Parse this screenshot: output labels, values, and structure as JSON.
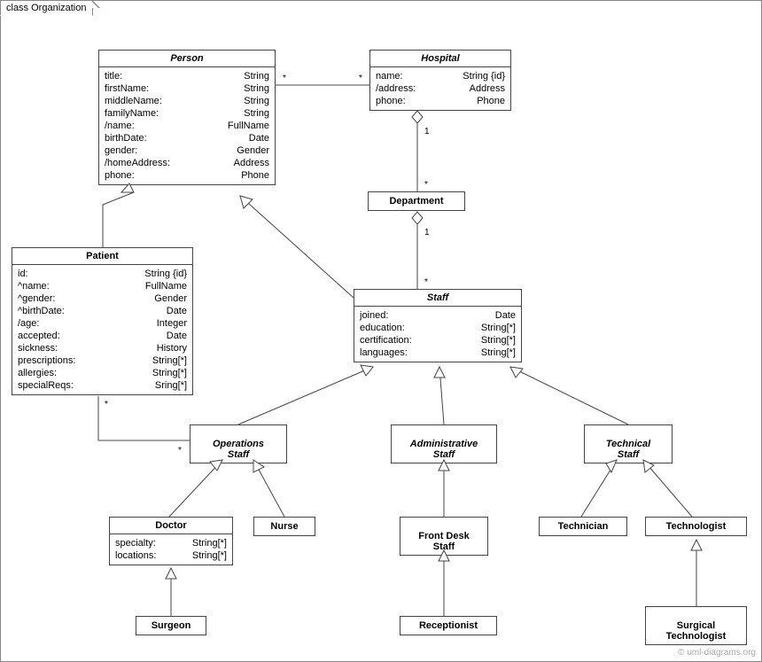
{
  "frame": {
    "title": "class Organization"
  },
  "classes": {
    "person": {
      "name": "Person",
      "attrs": [
        {
          "n": "title:",
          "t": "String"
        },
        {
          "n": "firstName:",
          "t": "String"
        },
        {
          "n": "middleName:",
          "t": "String"
        },
        {
          "n": "familyName:",
          "t": "String"
        },
        {
          "n": "/name:",
          "t": "FullName"
        },
        {
          "n": "birthDate:",
          "t": "Date"
        },
        {
          "n": "gender:",
          "t": "Gender"
        },
        {
          "n": "/homeAddress:",
          "t": "Address"
        },
        {
          "n": "phone:",
          "t": "Phone"
        }
      ]
    },
    "hospital": {
      "name": "Hospital",
      "attrs": [
        {
          "n": "name:",
          "t": "String {id}"
        },
        {
          "n": "/address:",
          "t": "Address"
        },
        {
          "n": "phone:",
          "t": "Phone"
        }
      ]
    },
    "department": {
      "name": "Department"
    },
    "patient": {
      "name": "Patient",
      "attrs": [
        {
          "n": "id:",
          "t": "String {id}"
        },
        {
          "n": "^name:",
          "t": "FullName"
        },
        {
          "n": "^gender:",
          "t": "Gender"
        },
        {
          "n": "^birthDate:",
          "t": "Date"
        },
        {
          "n": "/age:",
          "t": "Integer"
        },
        {
          "n": "accepted:",
          "t": "Date"
        },
        {
          "n": "sickness:",
          "t": "History"
        },
        {
          "n": "prescriptions:",
          "t": "String[*]"
        },
        {
          "n": "allergies:",
          "t": "String[*]"
        },
        {
          "n": "specialReqs:",
          "t": "Sring[*]"
        }
      ]
    },
    "staff": {
      "name": "Staff",
      "attrs": [
        {
          "n": "joined:",
          "t": "Date"
        },
        {
          "n": "education:",
          "t": "String[*]"
        },
        {
          "n": "certification:",
          "t": "String[*]"
        },
        {
          "n": "languages:",
          "t": "String[*]"
        }
      ]
    },
    "opsStaff": {
      "name": "Operations\nStaff"
    },
    "adminStaff": {
      "name": "Administrative\nStaff"
    },
    "techStaff": {
      "name": "Technical\nStaff"
    },
    "doctor": {
      "name": "Doctor",
      "attrs": [
        {
          "n": "specialty:",
          "t": "String[*]"
        },
        {
          "n": "locations:",
          "t": "String[*]"
        }
      ]
    },
    "nurse": {
      "name": "Nurse"
    },
    "frontDesk": {
      "name": "Front Desk\nStaff"
    },
    "technician": {
      "name": "Technician"
    },
    "technologist": {
      "name": "Technologist"
    },
    "surgeon": {
      "name": "Surgeon"
    },
    "receptionist": {
      "name": "Receptionist"
    },
    "surgTech": {
      "name": "Surgical\nTechnologist"
    }
  },
  "mults": {
    "personHospL": "*",
    "personHospR": "*",
    "hospDept1": "1",
    "hospDeptStar": "*",
    "deptStaff1": "1",
    "deptStaffStar": "*",
    "patientOpsP": "*",
    "patientOpsO": "*"
  },
  "watermark": "© uml-diagrams.org"
}
